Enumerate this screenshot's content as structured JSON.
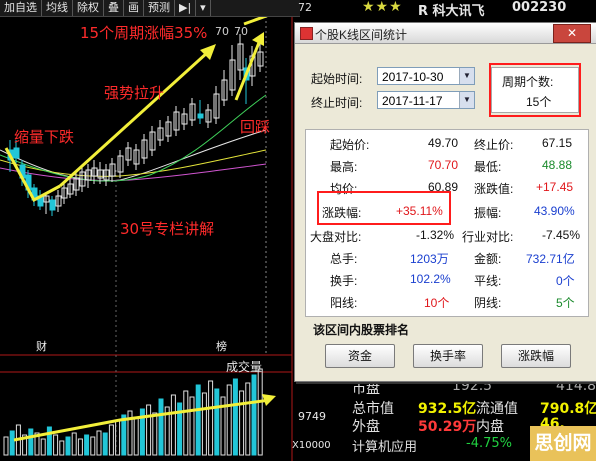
{
  "toolbar": {
    "items": [
      "加自选",
      "均线",
      "除权",
      "叠",
      "画",
      "预测",
      "▶|",
      "▾"
    ]
  },
  "header": {
    "stars": "★★★",
    "r_badge": "R",
    "stock_name": "科大讯飞",
    "stock_code": "002230"
  },
  "annotations": {
    "period_gain": "15个周期涨幅35%",
    "strong_rise": "强势拉升",
    "shrink_drop": "缩量下跌",
    "pullback": "回踩",
    "column": "30号专栏讲解",
    "peak_price_1": "70",
    "peak_price_2": "70"
  },
  "chart_labels": {
    "cai": "财",
    "bang": "榜",
    "volume_title": "成交量",
    "volume_value": "9749",
    "volume_unit": "X10000",
    "y_top": "72"
  },
  "colors": {
    "accent_red": "#ff1c1c",
    "up_candle": "#e8e8e8",
    "down_candle": "#22c6d8",
    "arrow_yellow": "#f2ef3a"
  },
  "dialog": {
    "title": "个股K线区间统计",
    "close_label": "✕",
    "start_label": "起始时间:",
    "start_value": "2017-10-30",
    "end_label": "终止时间:",
    "end_value": "2017-11-17",
    "period_label": "周期个数:",
    "period_value": "15个",
    "stats": {
      "start_price_label": "起始价:",
      "start_price": "49.70",
      "end_price_label": "终止价:",
      "end_price": "67.15",
      "high_label": "最高:",
      "high": "70.70",
      "low_label": "最低:",
      "low": "48.88",
      "avg_label": "均价:",
      "avg": "60.89",
      "change_label": "涨跌值:",
      "change": "+17.45",
      "pct_label": "涨跌幅:",
      "pct": "+35.11%",
      "amp_label": "振幅:",
      "amp": "43.90%",
      "market_label": "大盘对比:",
      "market": "-1.32%",
      "industry_label": "行业对比:",
      "industry": "-7.45%",
      "hands_label": "总手:",
      "hands": "1203万",
      "amount_label": "金额:",
      "amount": "732.71亿",
      "turnover_label": "换手:",
      "turnover": "102.2%",
      "flat_label": "平线:",
      "flat": "0个",
      "yang_label": "阳线:",
      "yang": "10个",
      "yin_label": "阴线:",
      "yin": "5个"
    },
    "rank_title": "该区间内股票排名",
    "buttons": [
      "资金",
      "换手率",
      "涨跌幅"
    ]
  },
  "quote": {
    "market_label": "市盘",
    "market_value": "192.5",
    "cap_label": "总市值",
    "cap_value": "932.5亿",
    "float_label": "流通值",
    "float_value": "790.8亿",
    "outer_label": "外盘",
    "outer_value": "50.29万",
    "inner_label": "内盘",
    "inner_value": "46.",
    "sector_label": "计算机应用",
    "sector_value": "-4.75%",
    "side_value": "414.8"
  },
  "watermark": "思创网"
}
